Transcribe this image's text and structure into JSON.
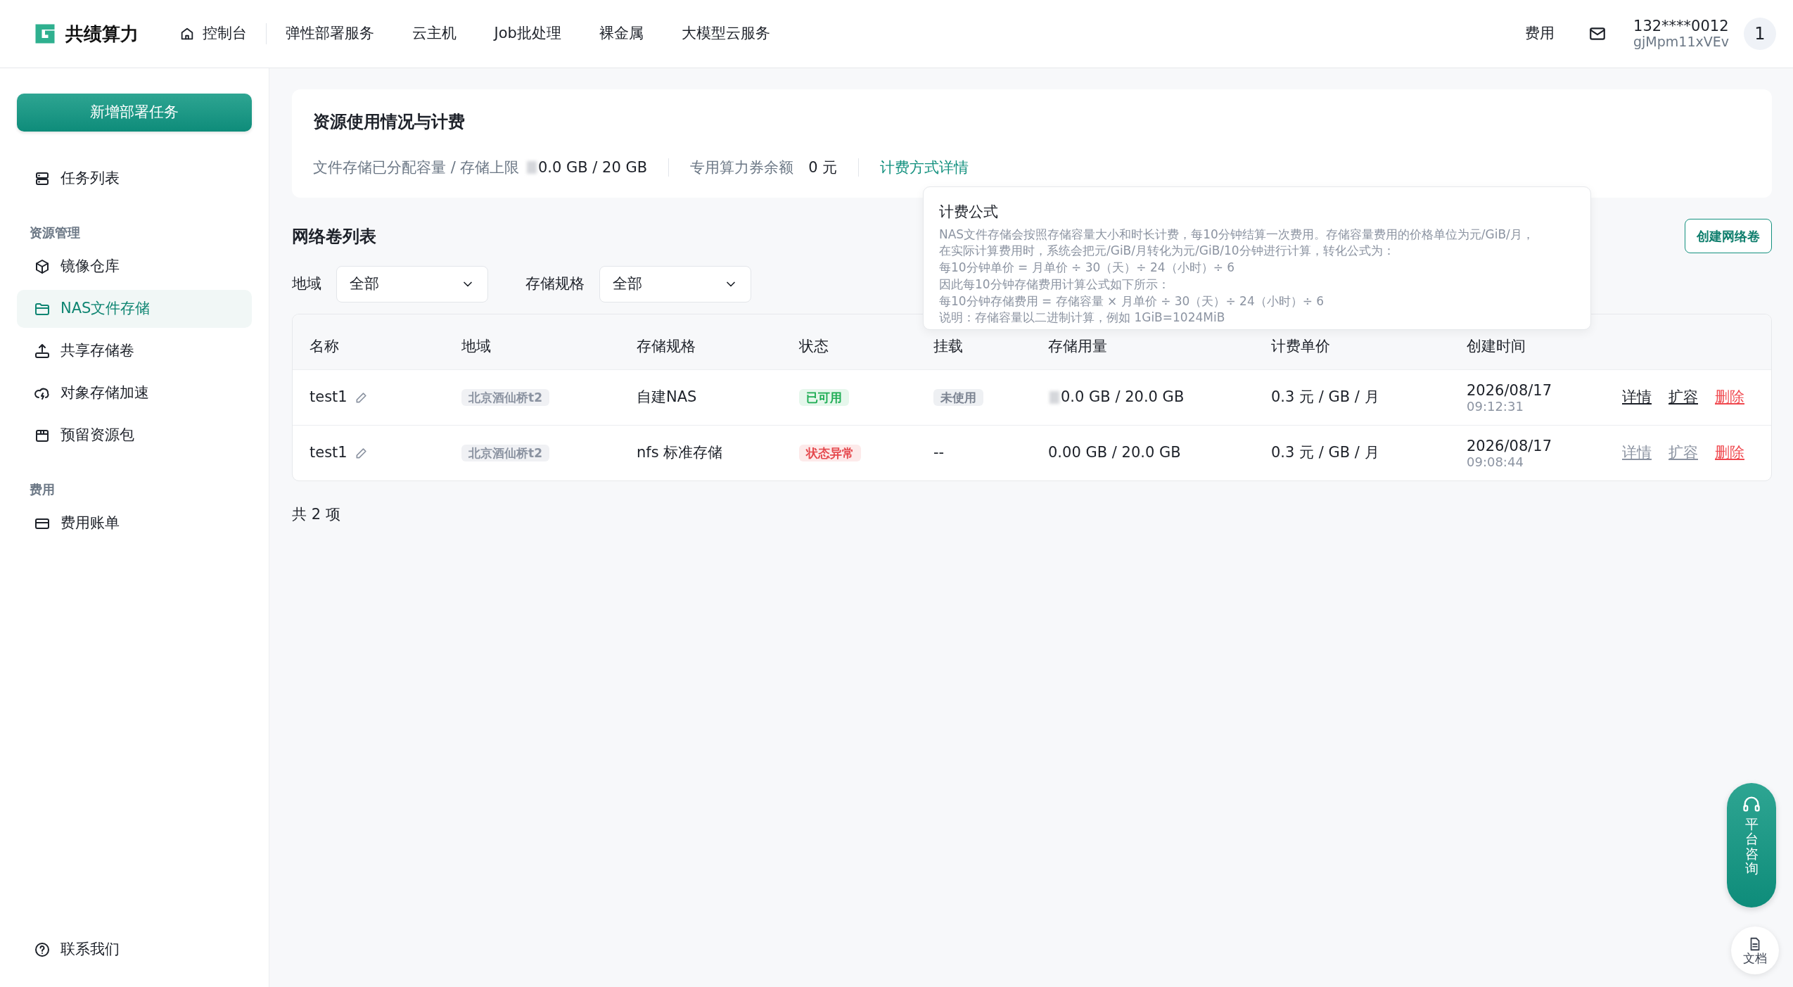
{
  "top_nav": {
    "brand": "共绩算力",
    "items": [
      {
        "label": "控制台",
        "kind": "home"
      },
      {
        "label": "弹性部署服务",
        "kind": "plain"
      },
      {
        "label": "云主机",
        "kind": "plain"
      },
      {
        "label": "Job批处理",
        "kind": "plain"
      },
      {
        "label": "裸金属",
        "kind": "plain"
      },
      {
        "label": "大模型云服务",
        "kind": "plain"
      }
    ],
    "fee": "费用",
    "user_phone": "132****0012",
    "user_id": "gjMpm11xVEv",
    "avatar": "1"
  },
  "sidebar": {
    "new_button": "新增部署任务",
    "sections": [
      {
        "items": [
          {
            "label": "任务列表",
            "selected": false,
            "kind": "server"
          }
        ]
      },
      {
        "title": "资源管理",
        "items": [
          {
            "label": "镜像仓库",
            "selected": false,
            "kind": "cube"
          },
          {
            "label": "NAS文件存储",
            "selected": true,
            "kind": "folder"
          },
          {
            "label": "共享存储卷",
            "selected": false,
            "kind": "upload"
          },
          {
            "label": "对象存储加速",
            "selected": false,
            "kind": "cloud"
          },
          {
            "label": "预留资源包",
            "selected": false,
            "kind": "package"
          }
        ]
      },
      {
        "title": "费用",
        "items": [
          {
            "label": "费用账单",
            "selected": false,
            "kind": "card"
          }
        ]
      }
    ],
    "contact": "联系我们"
  },
  "usage_card": {
    "title": "资源使用情况与计费",
    "stats": [
      {
        "label": "文件存储已分配容量 / 存储上限",
        "value": "0.0 GB / 20 GB",
        "masked": true
      },
      {
        "label": "专用算力券余额",
        "value": "0 元",
        "masked": false
      }
    ],
    "link": "计费方式详情"
  },
  "tooltip": {
    "title": "计费公式",
    "lines": [
      "NAS文件存储会按照存储容量大小和时长计费，每10分钟结算一次费用。存储容量费用的价格单位为元/GiB/月，",
      "在实际计算费用时，系统会把元/GiB/月转化为元/GiB/10分钟进行计算，转化公式为：",
      "每10分钟单价 = 月单价 ÷ 30（天）÷ 24（小时）÷ 6",
      "因此每10分钟存储费用计算公式如下所示：",
      "每10分钟存储费用 = 存储容量 × 月单价 ÷ 30（天）÷ 24（小时）÷ 6",
      "说明：存储容量以二进制计算，例如 1GiB=1024MiB"
    ]
  },
  "volumes": {
    "title": "网络卷列表",
    "create_button": "创建网络卷",
    "filters": [
      {
        "label": "地域",
        "value": "全部"
      },
      {
        "label": "存储规格",
        "value": "全部"
      }
    ],
    "columns": [
      "名称",
      "地域",
      "存储规格",
      "状态",
      "挂载",
      "存储用量",
      "计费单价",
      "创建时间"
    ],
    "rows": [
      {
        "name": "test1",
        "region": "北京酒仙桥t2",
        "spec": "自建NAS",
        "status": {
          "text": "已可用",
          "kind": "ok"
        },
        "mount": {
          "text": "未使用",
          "kind": "tag"
        },
        "usage": "0.0 GB / 20.0 GB",
        "usage_masked": true,
        "price": "0.3 元 / GB / 月",
        "created_date": "2026/08/17",
        "created_time": "09:12:31",
        "actions": [
          {
            "label": "详情",
            "kind": "link",
            "disabled": false
          },
          {
            "label": "扩容",
            "kind": "link",
            "disabled": false
          },
          {
            "label": "删除",
            "kind": "danger",
            "disabled": false
          }
        ]
      },
      {
        "name": "test1",
        "region": "北京酒仙桥t2",
        "spec": "nfs 标准存储",
        "status": {
          "text": "状态异常",
          "kind": "error"
        },
        "mount": {
          "text": "--",
          "kind": "plain"
        },
        "usage": "0.00 GB / 20.0 GB",
        "usage_masked": false,
        "price": "0.3 元 / GB / 月",
        "created_date": "2026/08/17",
        "created_time": "09:08:44",
        "actions": [
          {
            "label": "详情",
            "kind": "link",
            "disabled": true
          },
          {
            "label": "扩容",
            "kind": "link",
            "disabled": true
          },
          {
            "label": "删除",
            "kind": "danger",
            "disabled": false
          }
        ]
      }
    ],
    "total": "共 2 项"
  },
  "float": {
    "consult": "平台咨询",
    "docs": "文档"
  }
}
